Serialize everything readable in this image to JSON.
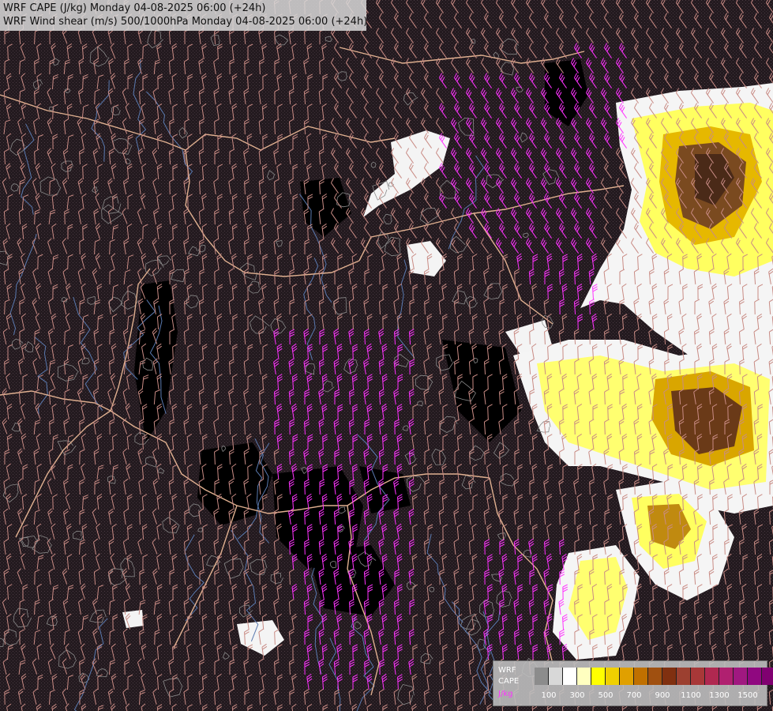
{
  "map": {
    "title_line1": "WRF CAPE (J/kg) Monday 04-08-2025 06:00 (+24h)",
    "title_line2": "WRF Wind shear (m/s) 500/1000hPa Monday 04-08-2025 06:00 (+24h)"
  },
  "legend": {
    "label_line1": "WRF",
    "label_line2": "CAPE",
    "units": "J/kg",
    "colors": [
      "#8c8c8c",
      "#d8d8d8",
      "#ffffff",
      "#ffffc0",
      "#ffff00",
      "#f0d000",
      "#e0a000",
      "#c07000",
      "#a05010",
      "#803010",
      "#9c4030",
      "#a83838",
      "#b02850",
      "#b02070",
      "#a01880",
      "#900880",
      "#800070"
    ],
    "tick_labels": [
      "100",
      "300",
      "500",
      "700",
      "900",
      "1100",
      "1300",
      "1500"
    ]
  },
  "colors": {
    "barb_shear_low": "#c98b84",
    "barb_shear_high": "#ff33ff",
    "border": "#e0b090",
    "river": "#5a7ab0",
    "terrain_contour": "#8a8a8a",
    "background": "#1c1418"
  }
}
